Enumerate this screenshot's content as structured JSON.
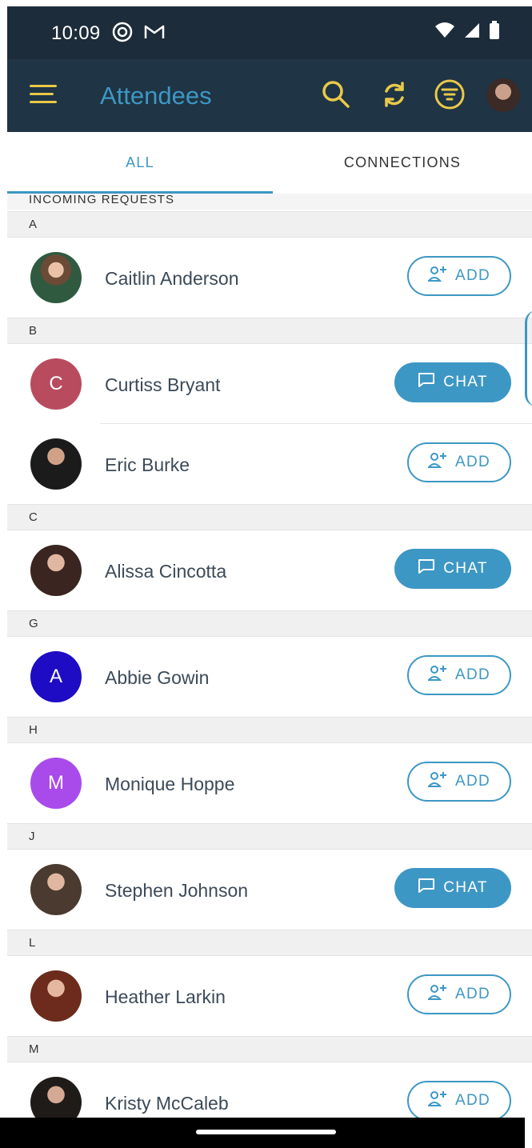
{
  "status_bar": {
    "time": "10:09"
  },
  "app_bar": {
    "title": "Attendees"
  },
  "tabs": [
    {
      "label": "ALL",
      "selected": true
    },
    {
      "label": "CONNECTIONS",
      "selected": false
    }
  ],
  "incoming_requests_label": "INCOMING REQUESTS",
  "list": [
    {
      "section": "A",
      "items": [
        {
          "name": "Caitlin Anderson",
          "avatar": "photo",
          "action": "ADD"
        }
      ]
    },
    {
      "section": "B",
      "items": [
        {
          "name": "Curtiss Bryant",
          "avatar": "C",
          "avatar_color": "#b84b5e",
          "action": "CHAT"
        },
        {
          "name": "Eric Burke",
          "avatar": "photo",
          "action": "ADD"
        }
      ]
    },
    {
      "section": "C",
      "items": [
        {
          "name": "Alissa Cincotta",
          "avatar": "photo",
          "action": "CHAT"
        }
      ]
    },
    {
      "section": "G",
      "items": [
        {
          "name": "Abbie Gowin",
          "avatar": "A",
          "avatar_color": "#1e0cc4",
          "action": "ADD"
        }
      ]
    },
    {
      "section": "H",
      "items": [
        {
          "name": "Monique Hoppe",
          "avatar": "M",
          "avatar_color": "#a94bea",
          "action": "ADD"
        }
      ]
    },
    {
      "section": "J",
      "items": [
        {
          "name": "Stephen Johnson",
          "avatar": "photo",
          "action": "CHAT"
        }
      ]
    },
    {
      "section": "L",
      "items": [
        {
          "name": "Heather Larkin",
          "avatar": "photo",
          "action": "ADD"
        }
      ]
    },
    {
      "section": "M",
      "items": [
        {
          "name": "Kristy McCaleb",
          "avatar": "photo",
          "action": "ADD"
        }
      ]
    }
  ],
  "colors": {
    "accent": "#3d97c4",
    "app_bar": "#1f3444",
    "status_bar": "#1d2c3a",
    "icon_yellow": "#e9c94a"
  }
}
